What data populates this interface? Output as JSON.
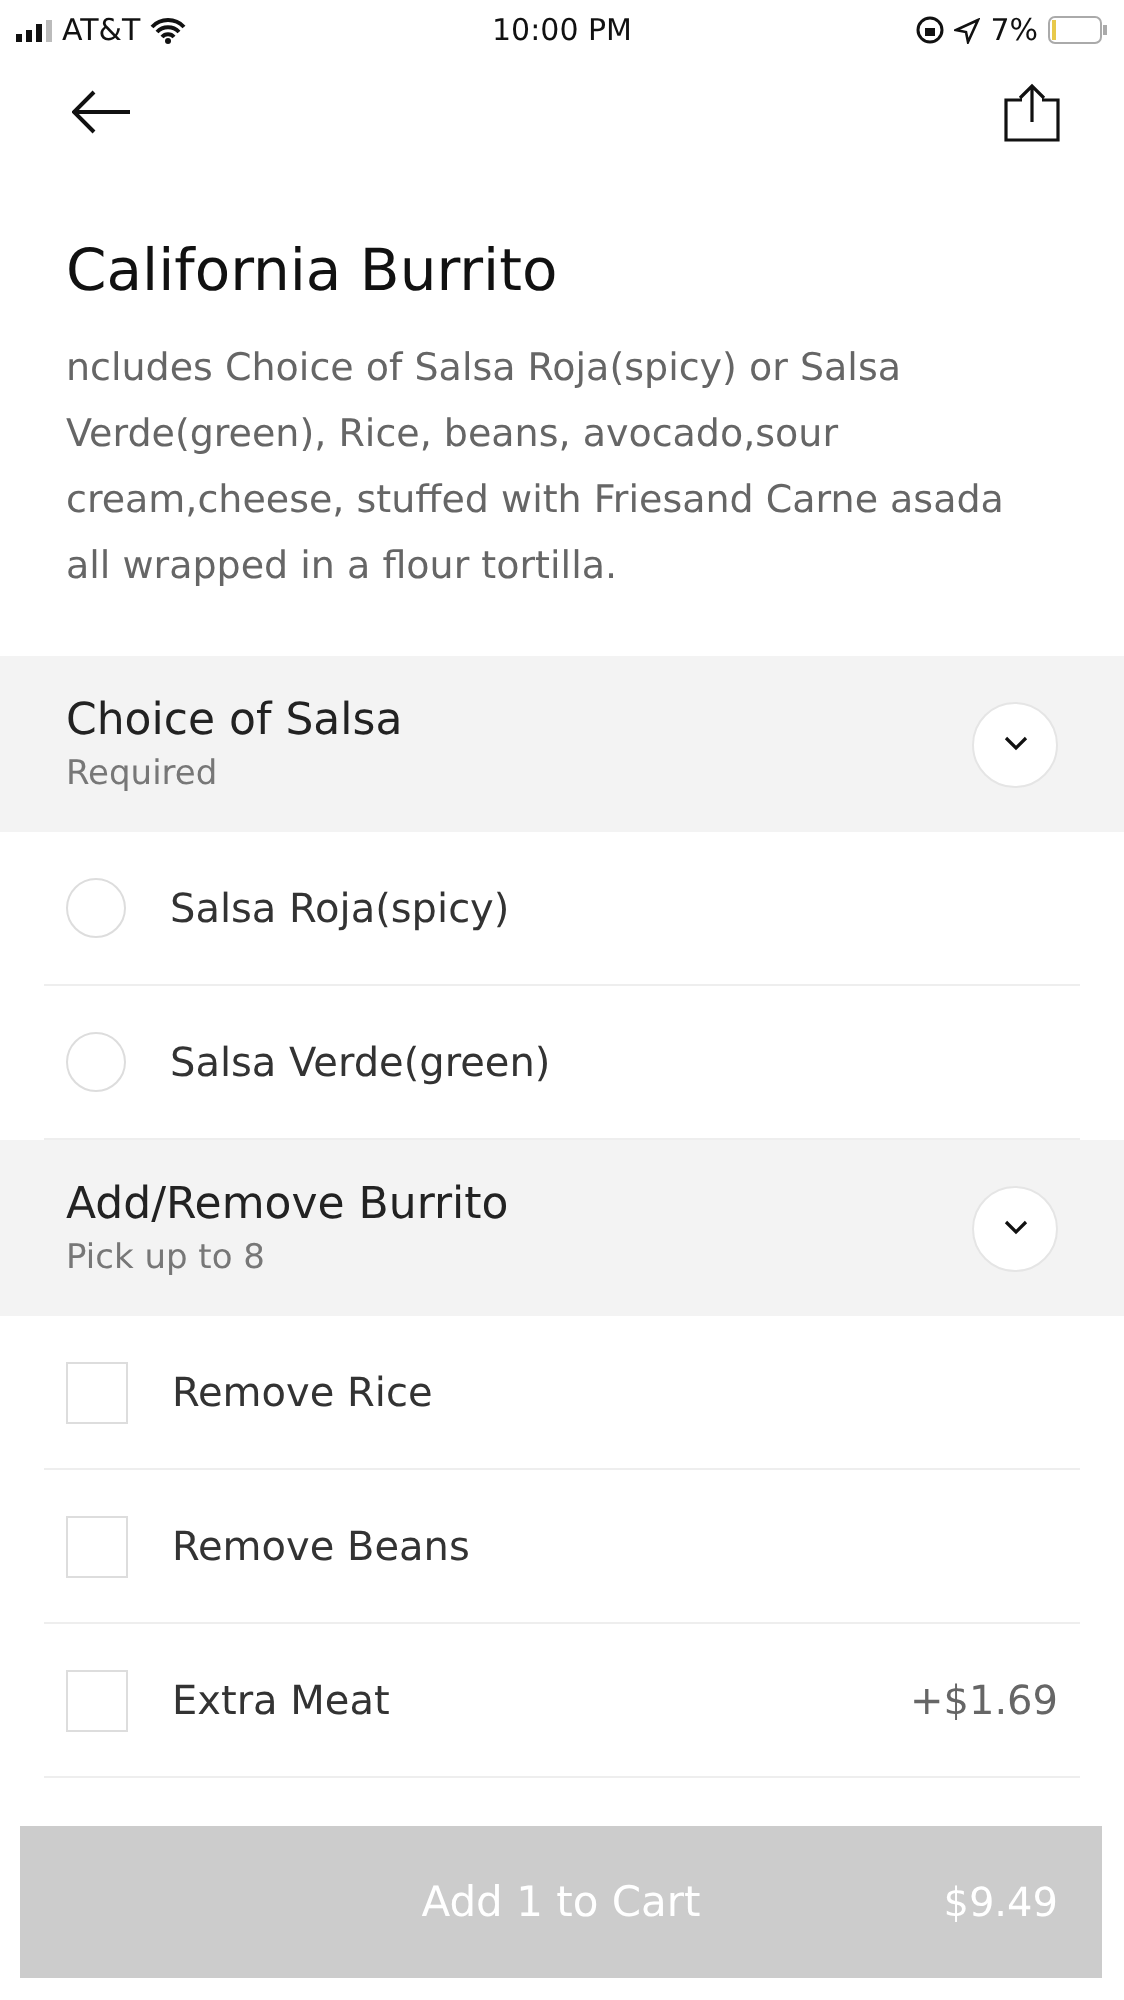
{
  "status_bar": {
    "carrier": "AT&T",
    "time": "10:00 PM",
    "battery": "7%"
  },
  "item": {
    "title": "California Burrito",
    "description": "ncludes Choice of Salsa Roja(spicy) or Salsa Verde(green), Rice, beans, avocado,sour cream,cheese, stuffed with Friesand Carne asada all wrapped in a flour tortilla."
  },
  "sections": [
    {
      "title": "Choice of Salsa",
      "subtitle": "Required",
      "options": [
        {
          "kind": "radio",
          "label": "Salsa Roja(spicy)",
          "checked": false
        },
        {
          "kind": "radio",
          "label": "Salsa Verde(green)",
          "checked": false
        }
      ]
    },
    {
      "title": "Add/Remove Burrito",
      "subtitle": "Pick up to 8",
      "options": [
        {
          "kind": "checkbox",
          "label": "Remove Rice",
          "checked": false
        },
        {
          "kind": "checkbox",
          "label": "Remove Beans",
          "checked": false
        },
        {
          "kind": "checkbox",
          "label": "Extra Meat",
          "checked": false,
          "price": "+$1.69"
        }
      ]
    }
  ],
  "cart_button": {
    "label": "Add 1 to Cart",
    "price": "$9.49",
    "disabled": true
  }
}
